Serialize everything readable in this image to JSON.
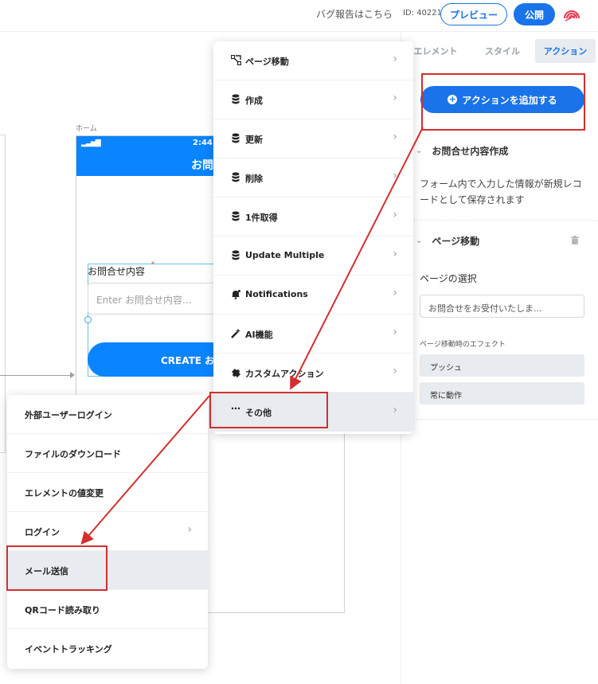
{
  "header": {
    "bug_report": "バグ報告はこちら",
    "app_id": "ID: 40221",
    "preview": "プレビュー",
    "publish": "公開"
  },
  "canvas": {
    "screen_label": "ホーム",
    "phone": {
      "time": "2:44",
      "title": "お問",
      "required_mark": "*",
      "field_label": "お問合せ内容",
      "field_placeholder": "Enter お問合せ内容...",
      "button_label": "CREATE お問"
    }
  },
  "panel": {
    "tabs": [
      "エレメント",
      "スタイル",
      "アクション"
    ],
    "add_action": "アクションを追加する",
    "section1": {
      "title": "お問合せ内容作成",
      "description": "フォーム内で入力した情報が新規レコードとして保存されます"
    },
    "section2": {
      "title": "ページ移動",
      "page_select_label": "ページの選択",
      "page_select_value": "お問合せをお受付いたしま...",
      "effect_label": "ページ移動時のエフェクト",
      "effect_value": "プッシュ",
      "timing_value": "常に動作"
    }
  },
  "action_menu": {
    "items": [
      {
        "label": "ページ移動",
        "icon": "page-link-icon"
      },
      {
        "label": "作成",
        "icon": "database-icon"
      },
      {
        "label": "更新",
        "icon": "database-icon"
      },
      {
        "label": "削除",
        "icon": "database-icon"
      },
      {
        "label": "1件取得",
        "icon": "database-icon"
      },
      {
        "label": "Update Multiple",
        "icon": "database-icon"
      },
      {
        "label": "Notifications",
        "icon": "bell-icon"
      },
      {
        "label": "AI機能",
        "icon": "magic-wand-icon"
      },
      {
        "label": "カスタムアクション",
        "icon": "puzzle-icon"
      },
      {
        "label": "その他",
        "icon": "ellipsis-icon"
      }
    ]
  },
  "sub_menu": {
    "items": [
      {
        "label": "外部ユーザーログイン"
      },
      {
        "label": "ファイルのダウンロード"
      },
      {
        "label": "エレメントの値変更"
      },
      {
        "label": "ログイン"
      },
      {
        "label": "メール送信"
      },
      {
        "label": "QRコード読み取り"
      },
      {
        "label": "イベントトラッキング"
      }
    ]
  },
  "colors": {
    "brand_blue": "#1a73e8",
    "phone_blue": "#0a84ff",
    "highlight_red": "#d32f2f"
  }
}
